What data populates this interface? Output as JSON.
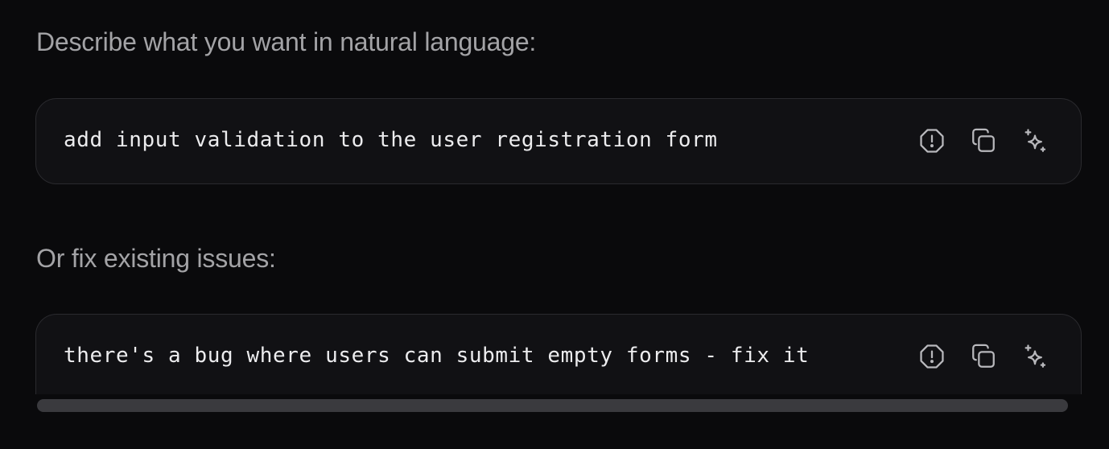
{
  "sections": [
    {
      "label": "Describe what you want in natural language:",
      "code": "add input validation to the user registration form",
      "icons": [
        "report-issue-icon",
        "copy-icon",
        "sparkle-icon"
      ]
    },
    {
      "label": "Or fix existing issues:",
      "code": "there's a bug where users can submit empty forms - fix it",
      "icons": [
        "report-issue-icon",
        "copy-icon",
        "sparkle-icon"
      ]
    }
  ],
  "colors": {
    "background": "#0a0a0c",
    "box_background": "#111114",
    "box_border": "#2a2a2e",
    "label_text": "#a3a3a6",
    "code_text": "#ececee",
    "icon": "#b8b8bc",
    "scrollbar_thumb": "#3a3a3e"
  }
}
